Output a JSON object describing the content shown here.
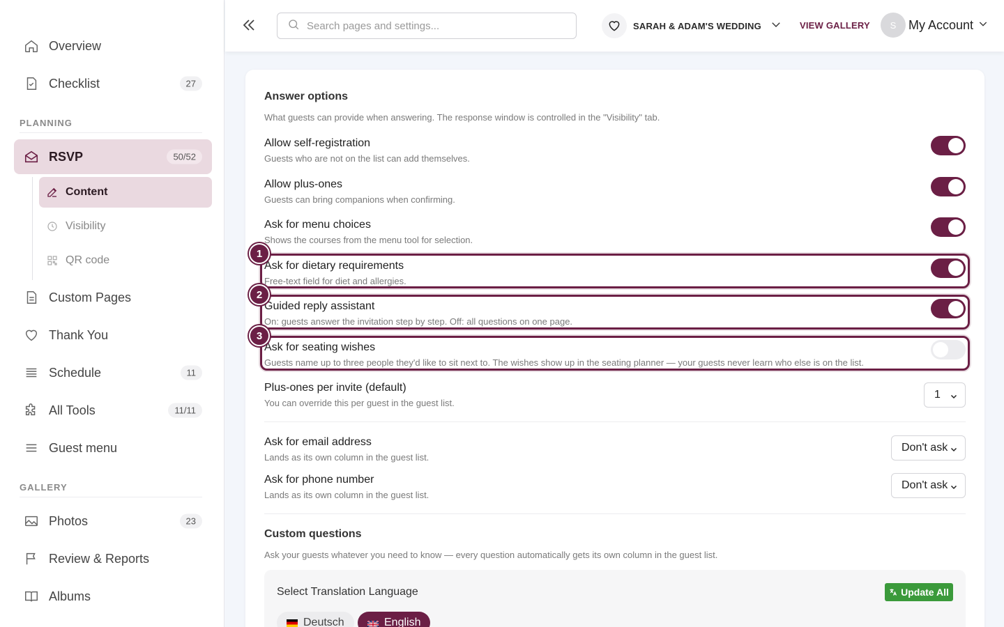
{
  "sidebar": {
    "top_items": [
      {
        "label": "Overview",
        "badge": ""
      },
      {
        "label": "Checklist",
        "badge": "27"
      }
    ],
    "planning_title": "PLANNING",
    "rsvp": {
      "label": "RSVP",
      "badge": "50/52"
    },
    "rsvp_sub": [
      {
        "label": "Content"
      },
      {
        "label": "Visibility"
      },
      {
        "label": "QR code"
      }
    ],
    "planning_items": [
      {
        "label": "Custom Pages",
        "badge": ""
      },
      {
        "label": "Thank You",
        "badge": ""
      },
      {
        "label": "Schedule",
        "badge": "11"
      },
      {
        "label": "All Tools",
        "badge": "11/11"
      },
      {
        "label": "Guest menu",
        "badge": ""
      }
    ],
    "gallery_title": "GALLERY",
    "gallery_items": [
      {
        "label": "Photos",
        "badge": "23"
      },
      {
        "label": "Review & Reports",
        "badge": ""
      },
      {
        "label": "Albums",
        "badge": ""
      }
    ]
  },
  "header": {
    "search_placeholder": "Search pages and settings...",
    "wedding_name": "SARAH & ADAM'S WEDDING",
    "view_gallery": "VIEW GALLERY",
    "avatar_initial": "S",
    "account_label": "My Account"
  },
  "answer_options": {
    "title": "Answer options",
    "description": "What guests can provide when answering. The response window is controlled in the \"Visibility\" tab.",
    "toggles": [
      {
        "title": "Allow self-registration",
        "desc": "Guests who are not on the list can add themselves.",
        "on": true
      },
      {
        "title": "Allow plus-ones",
        "desc": "Guests can bring companions when confirming.",
        "on": true
      },
      {
        "title": "Ask for menu choices",
        "desc": "Shows the courses from the menu tool for selection.",
        "on": true
      },
      {
        "title": "Ask for dietary requirements",
        "desc": "Free-text field for diet and allergies.",
        "on": true,
        "highlight": "1"
      },
      {
        "title": "Guided reply assistant",
        "desc": "On: guests answer the invitation step by step. Off: all questions on one page.",
        "on": true,
        "highlight": "2"
      },
      {
        "title": "Ask for seating wishes",
        "desc": "Guests name up to three people they'd like to sit next to. The wishes show up in the seating planner — your guests never learn who else is on the list.",
        "on": false,
        "highlight": "3"
      }
    ],
    "plus_ones": {
      "title": "Plus-ones per invite (default)",
      "desc": "You can override this per guest in the guest list.",
      "value": "1"
    },
    "email": {
      "title": "Ask for email address",
      "desc": "Lands as its own column in the guest list.",
      "value": "Don't ask"
    },
    "phone": {
      "title": "Ask for phone number",
      "desc": "Lands as its own column in the guest list.",
      "value": "Don't ask"
    }
  },
  "custom_questions": {
    "title": "Custom questions",
    "description": "Ask your guests whatever you need to know — every question automatically gets its own column in the guest list."
  },
  "translation": {
    "title": "Select Translation Language",
    "update_all": "Update All",
    "languages": [
      {
        "label": "Deutsch",
        "selected": false
      },
      {
        "label": "English",
        "selected": true
      }
    ]
  },
  "colors": {
    "accent": "#6b1f45",
    "accent_soft": "#ead9e0",
    "success": "#3b9a3b"
  }
}
